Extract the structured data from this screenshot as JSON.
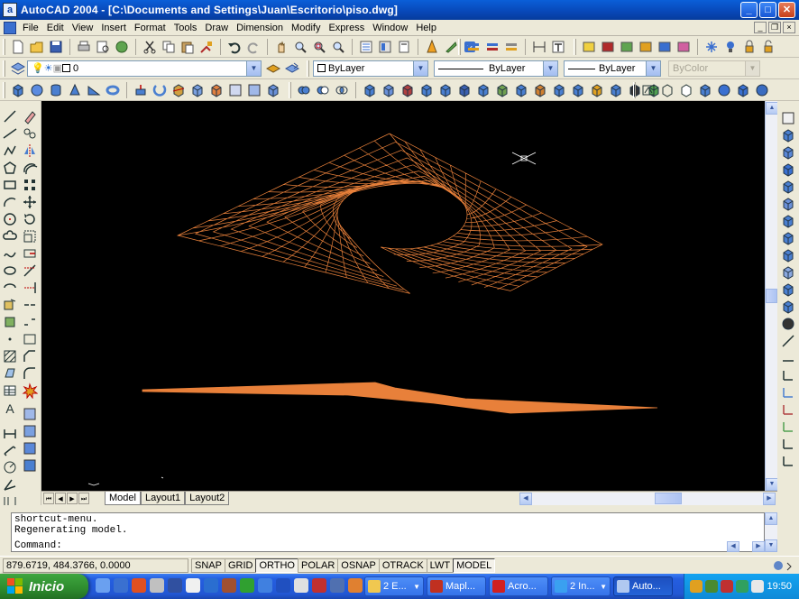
{
  "window": {
    "title": "AutoCAD 2004 - [C:\\Documents and Settings\\Juan\\Escritorio\\piso.dwg]",
    "app_icon_letter": "a",
    "minimize": "_",
    "maximize": "□",
    "close": "✕"
  },
  "menu": {
    "items": [
      "File",
      "Edit",
      "View",
      "Insert",
      "Format",
      "Tools",
      "Draw",
      "Dimension",
      "Modify",
      "Express",
      "Window",
      "Help"
    ]
  },
  "layers": {
    "current_layer": "0"
  },
  "properties": {
    "color": "ByLayer",
    "linetype": "ByLayer",
    "lineweight": "ByLayer",
    "plotstyle": "ByColor"
  },
  "tabs": {
    "items": [
      "Model",
      "Layout1",
      "Layout2"
    ],
    "active": "Model"
  },
  "command": {
    "lines": [
      "shortcut-menu.",
      "Regenerating model.",
      "Command:"
    ]
  },
  "status": {
    "coordinates": "879.6719, 484.3766, 0.0000",
    "toggles": [
      {
        "label": "SNAP",
        "on": false
      },
      {
        "label": "GRID",
        "on": false
      },
      {
        "label": "ORTHO",
        "on": true
      },
      {
        "label": "POLAR",
        "on": false
      },
      {
        "label": "OSNAP",
        "on": false
      },
      {
        "label": "OTRACK",
        "on": false
      },
      {
        "label": "LWT",
        "on": false
      },
      {
        "label": "MODEL",
        "on": true
      }
    ]
  },
  "taskbar": {
    "start_label": "Inicio",
    "tasks": [
      "2 E...",
      "Mapl...",
      "Acro...",
      "2 In...",
      "Auto..."
    ],
    "active_task": "Auto...",
    "clock": "19:50"
  },
  "colors": {
    "drawing_bg": "#000000",
    "mesh_stroke": "#e8803a",
    "titlebar": "#0a5fd8",
    "taskbar": "#245ee0"
  }
}
